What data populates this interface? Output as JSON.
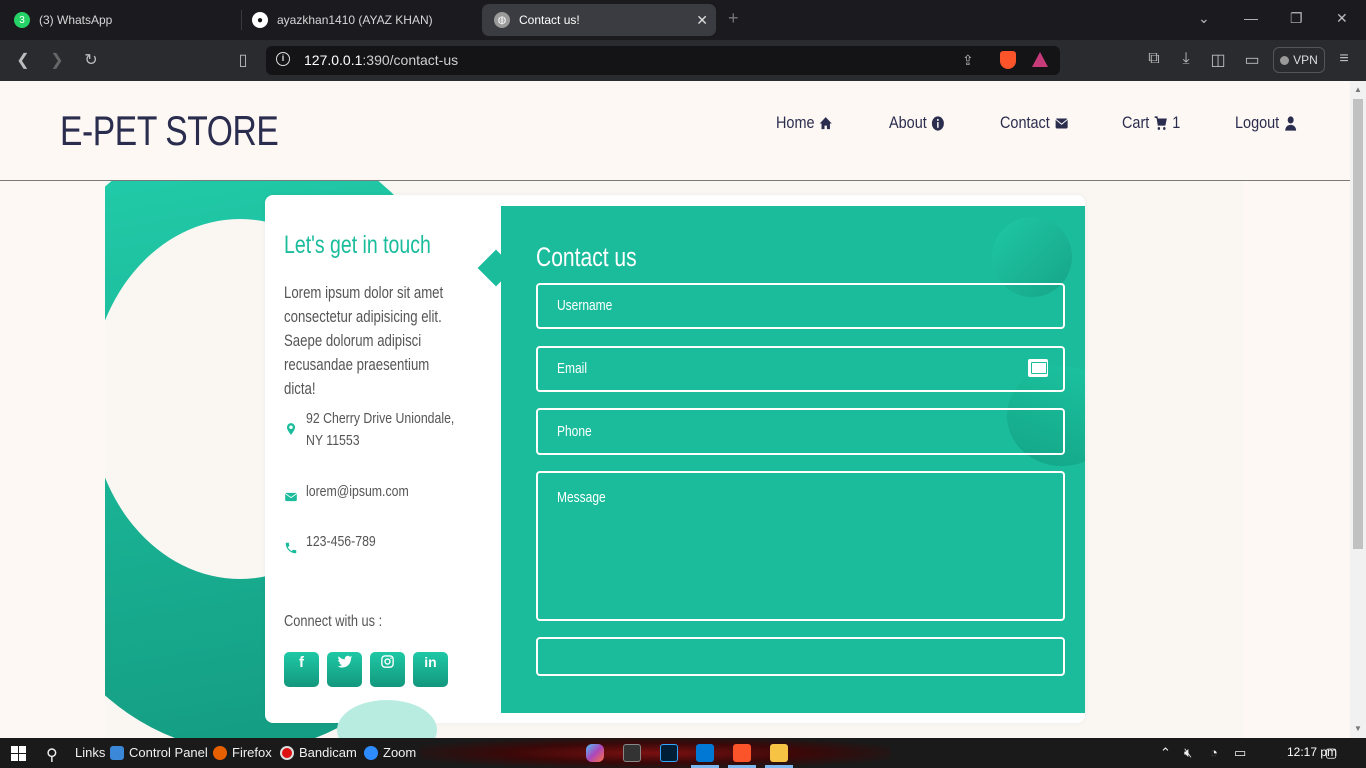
{
  "browser": {
    "tabs": [
      {
        "label": "(3) WhatsApp",
        "icon": "whatsapp-icon",
        "badge": "3"
      },
      {
        "label": "ayazkhan1410 (AYAZ KHAN)",
        "icon": "github-icon"
      },
      {
        "label": "Contact us!",
        "icon": "globe-icon",
        "active": true
      }
    ],
    "url_host": "127.0.0.1",
    "url_rest": ":390/contact-us",
    "vpn_label": "VPN"
  },
  "site": {
    "brand": "E-PET STORE",
    "nav": [
      {
        "label": "Home",
        "icon": "home-icon"
      },
      {
        "label": "About",
        "icon": "info-icon"
      },
      {
        "label": "Contact",
        "icon": "envelope-icon"
      },
      {
        "label": "Cart",
        "icon": "cart-icon",
        "count": "1"
      },
      {
        "label": "Logout",
        "icon": "user-icon"
      }
    ]
  },
  "contact_info": {
    "title": "Let's get in touch",
    "text": "Lorem ipsum dolor sit amet consectetur adipisicing elit. Saepe dolorum adipisci recusandae praesentium dicta!",
    "address_line1": "92 Cherry Drive Uniondale,",
    "address_line2": "NY 11553",
    "email": "lorem@ipsum.com",
    "phone": "123-456-789",
    "connect": "Connect with us :",
    "social": [
      "f",
      "t",
      "ig",
      "in"
    ]
  },
  "form": {
    "title": "Contact us",
    "username_placeholder": "Username",
    "email_placeholder": "Email",
    "phone_placeholder": "Phone",
    "message_placeholder": "Message",
    "submit_label": ""
  },
  "taskbar": {
    "links": "Links",
    "control_panel": "Control Panel",
    "firefox": "Firefox",
    "bandicam": "Bandicam",
    "zoom": "Zoom",
    "time": "12:17 pm"
  },
  "colors": {
    "accent": "#1abc9c",
    "brand_text": "#2b2d4e",
    "page_bg": "#fdf8f4"
  }
}
